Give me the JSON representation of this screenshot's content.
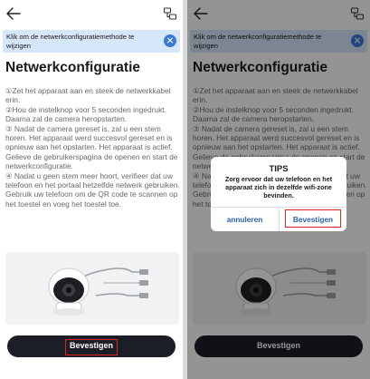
{
  "banner": {
    "text": "Klik om de netwerkconfiguratiemethode te wijzigen"
  },
  "page_title": "Netwerkconfiguratie",
  "steps": [
    "①Zet het apparaat aan en steek de netwerkkabel erin.",
    "②Hou de instelknop voor 5 seconden ingedrukt. Daarna zal de camera heropstarten.",
    "③ Nadat de camera gereset is, zal u een stem horen. Het apparaat werd succesvol gereset en is opnieuw aan het opstarten. Het apparaat is actief. Gelieve de gebruikerspagina de openen en start de netwerkconfiguratie.",
    "④ Nadat u geen stem meer hoort, verifieer dat uw telefoon en het portaal hetzelfde netwerk gebruiken. Gebruik uw telefoon om de QR code te scannen op het toestel en voeg het toestel toe."
  ],
  "confirm_label": "Bevestigen",
  "dialog": {
    "title": "TIPS",
    "message": "Zorg ervoor dat uw telefoon en het apparaat zich in dezelfde wifi-zone bevinden.",
    "cancel_label": "annuleren",
    "confirm_label": "Bevestigen"
  },
  "colors": {
    "banner_bg": "#d6e6fb",
    "banner_close": "#3b7ad9",
    "button_bg": "#1b1e26",
    "highlight": "#e02424",
    "dialog_link": "#2b5fae"
  },
  "icons": {
    "back": "arrow-left",
    "network": "network-config",
    "close": "close-x"
  }
}
